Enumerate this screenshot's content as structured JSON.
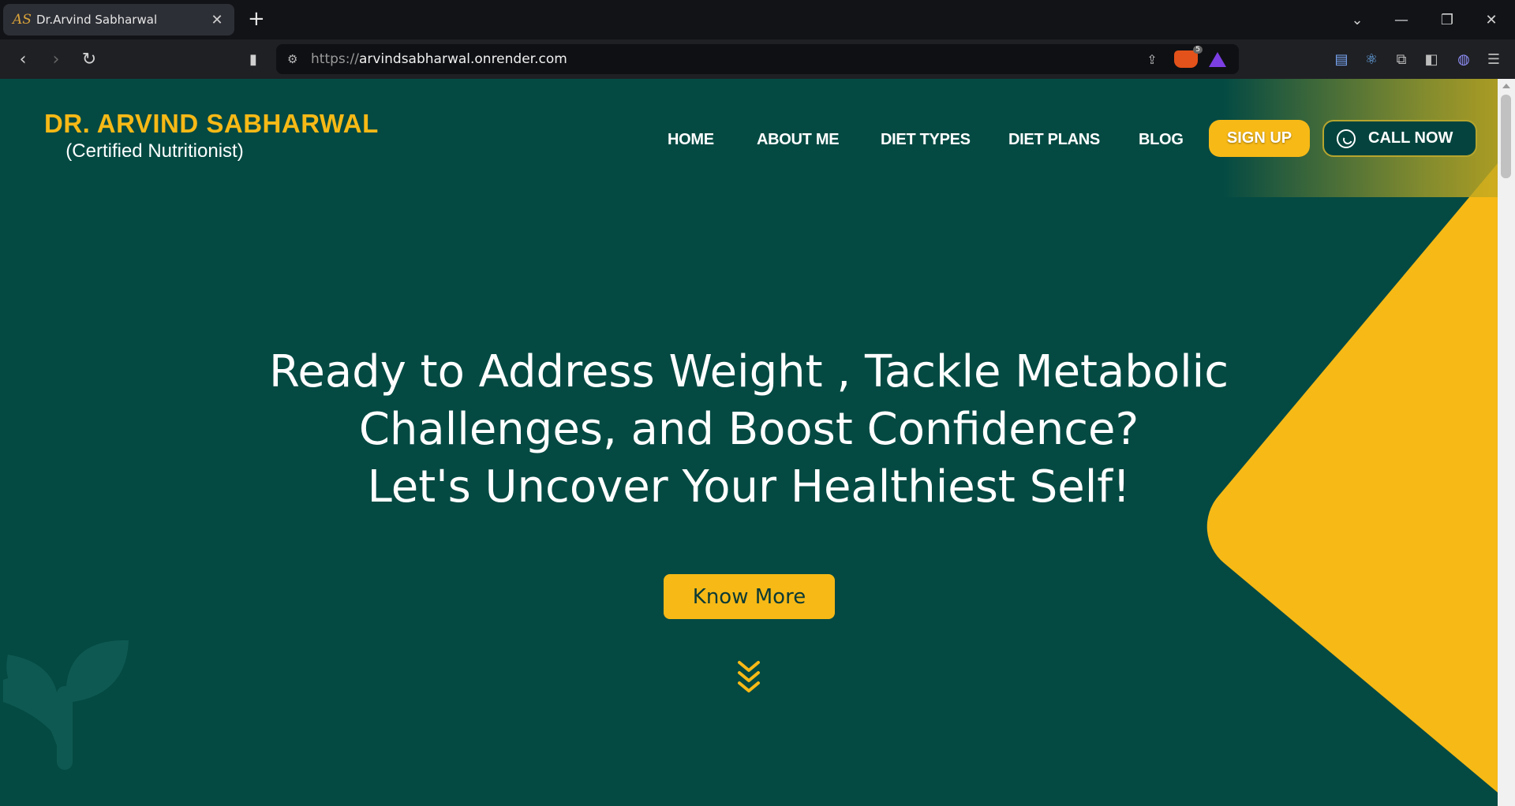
{
  "browser": {
    "tab_title": "Dr.Arvind Sabharwal",
    "tab_favicon": "AS",
    "url_protocol": "https://",
    "url_host": "arvindsabharwal.onrender.com",
    "brave_badge": "5"
  },
  "site": {
    "brand_name": "DR. ARVIND SABHARWAL",
    "brand_subtitle": "(Certified Nutritionist)",
    "nav": {
      "home": "HOME",
      "about": "ABOUT ME",
      "diet_types": "DIET TYPES",
      "diet_plans": "DIET PLANS",
      "blog": "BLOG"
    },
    "signup_label": "SIGN UP",
    "call_label": "CALL NOW",
    "hero": {
      "line1": "Ready to Address Weight , Tackle Metabolic",
      "line2": "Challenges, and Boost Confidence?",
      "line3": "Let's Uncover Your Healthiest Self!"
    },
    "know_more_label": "Know More"
  },
  "colors": {
    "page_bg": "#044a43",
    "accent": "#f7b916",
    "text": "#ffffff"
  }
}
